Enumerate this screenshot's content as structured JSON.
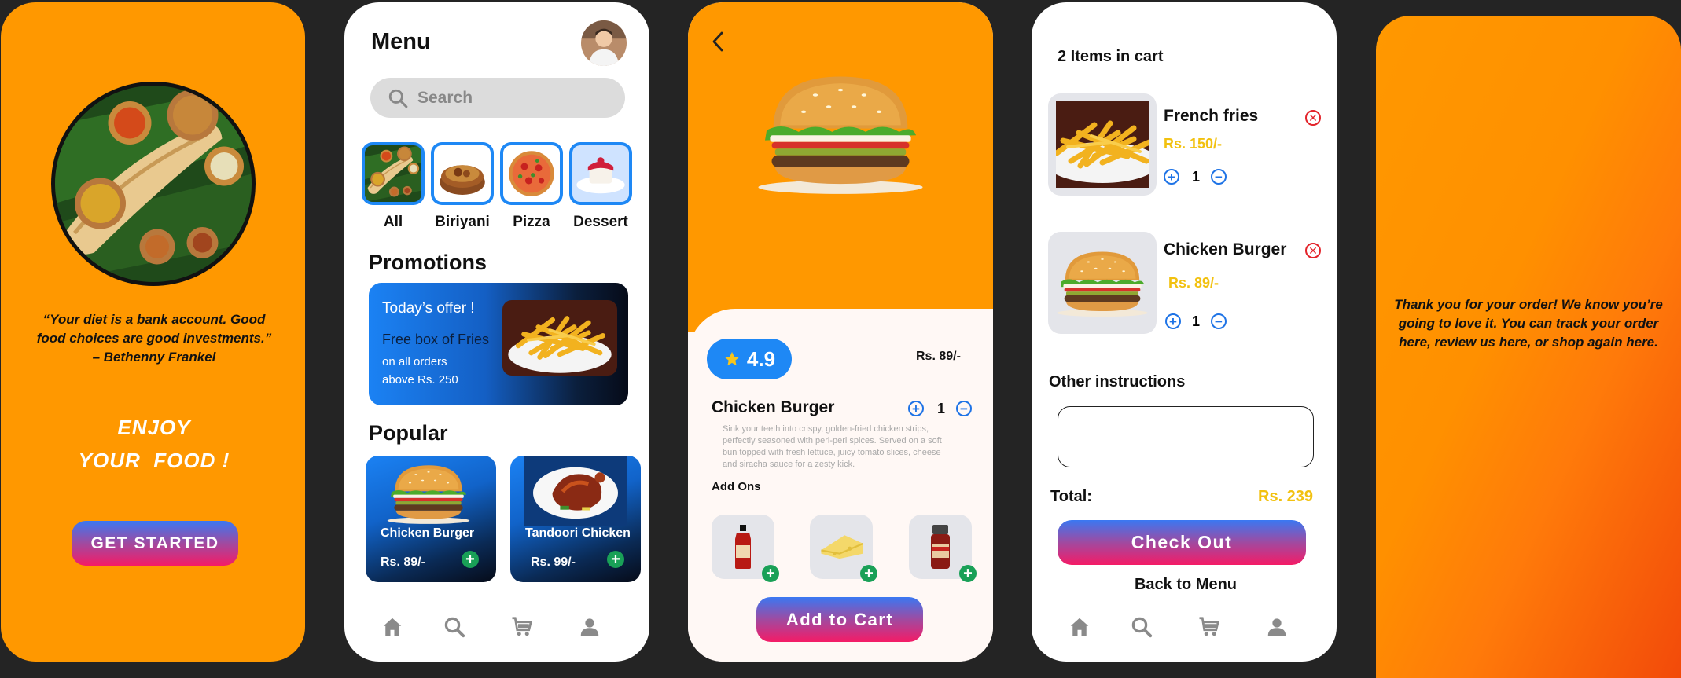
{
  "welcome": {
    "quote": "“Your diet is a bank account. Good food choices are good investments.” – Bethenny Frankel",
    "enjoy_line1": "ENJOY",
    "enjoy_line2": "YOUR  FOOD !",
    "cta": "GET STARTED"
  },
  "menu": {
    "title": "Menu",
    "search_placeholder": "Search",
    "categories": [
      "All",
      "Biriyani",
      "Pizza",
      "Dessert"
    ],
    "promotions_title": "Promotions",
    "promo": {
      "title": "Today’s offer !",
      "headline": "Free box of Fries",
      "line1": "on all orders",
      "line2": "above Rs. 250"
    },
    "popular_title": "Popular",
    "popular": [
      {
        "name": "Chicken Burger",
        "price": "Rs. 89/-"
      },
      {
        "name": "Tandoori Chicken",
        "price": "Rs. 99/-"
      }
    ]
  },
  "detail": {
    "rating": "4.9",
    "price": "Rs. 89/-",
    "name": "Chicken Burger",
    "qty": "1",
    "description": "Sink your teeth into crispy, golden-fried chicken strips, perfectly seasoned with peri-peri spices. Served on a soft bun topped with fresh lettuce, juicy tomato slices, cheese and siracha sauce for a zesty kick.",
    "addons_title": "Add Ons",
    "cta": "Add to Cart"
  },
  "cart": {
    "title": "2 Items in cart",
    "items": [
      {
        "name": "French fries",
        "price": "Rs. 150/-",
        "qty": "1"
      },
      {
        "name": "Chicken Burger",
        "price": "Rs. 89/-",
        "qty": "1"
      }
    ],
    "instructions_label": "Other instructions",
    "total_label": "Total:",
    "total_value": "Rs. 239",
    "checkout": "Check Out",
    "back": "Back to Menu"
  },
  "thanks": {
    "message": "Thank you for your order! We know you’re going to love it. You can track your order here, review us here, or shop again here."
  },
  "colors": {
    "orange": "#ff9800",
    "blue": "#1e88f5",
    "pink": "#f51b66",
    "green": "#19a057",
    "yellow": "#f2c10f",
    "red": "#e3242b"
  },
  "icons": {
    "nav": [
      "home-icon",
      "search-icon",
      "cart-icon",
      "profile-icon"
    ]
  }
}
